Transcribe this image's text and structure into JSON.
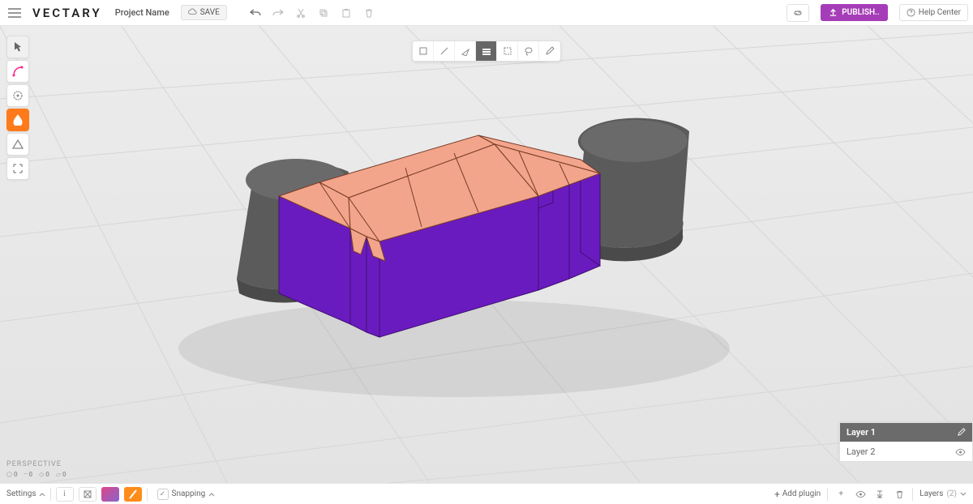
{
  "app": {
    "logo": "VECTARY",
    "project_name": "Project Name",
    "save_label": "SAVE",
    "publish_label": "PUBLISH..",
    "help_label": "Help Center"
  },
  "hud": {
    "title": "PERSPECTIVE",
    "verts": "0",
    "edges": "0",
    "faces": "0",
    "objs": "0"
  },
  "bottombar": {
    "settings": "Settings",
    "snapping": "Snapping",
    "add_plugin": "Add plugin",
    "layers_label": "Layers",
    "layers_count": "(2)"
  },
  "layers": {
    "active": "Layer 1",
    "items": [
      "Layer 2"
    ]
  }
}
